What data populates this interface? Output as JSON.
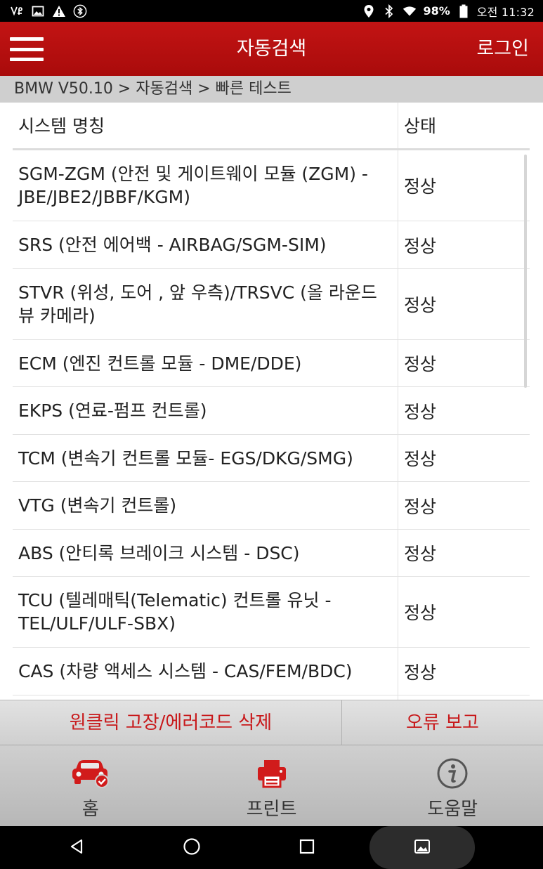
{
  "status_bar": {
    "battery": "98%",
    "time": "오전 11:32"
  },
  "app_bar": {
    "title": "자동검색",
    "login": "로그인"
  },
  "breadcrumb": "BMW V50.10 > 자동검색 > 빠른 테스트",
  "table": {
    "headers": [
      "시스템 명칭",
      "상태"
    ],
    "rows": [
      {
        "name": "SGM-ZGM (안전 및 게이트웨이 모듈 (ZGM) - JBE/JBE2/JBBF/KGM)",
        "status": "정상"
      },
      {
        "name": "SRS (안전 에어백 - AIRBAG/SGM-SIM)",
        "status": "정상"
      },
      {
        "name": "STVR (위성, 도어 , 앞 우측)/TRSVC (올 라운드 뷰 카메라)",
        "status": "정상"
      },
      {
        "name": "ECM (엔진 컨트롤 모듈 - DME/DDE)",
        "status": "정상"
      },
      {
        "name": "EKPS (연료-펌프 컨트롤)",
        "status": "정상"
      },
      {
        "name": "TCM (변속기 컨트롤 모듈- EGS/DKG/SMG)",
        "status": "정상"
      },
      {
        "name": "VTG (변속기 컨트롤)",
        "status": "정상"
      },
      {
        "name": "ABS (안티록 브레이크 시스템 - DSC)",
        "status": "정상"
      },
      {
        "name": "TCU (텔레매틱(Telematic) 컨트롤 유닛 - TEL/ULF/ULF-SBX)",
        "status": "정상"
      },
      {
        "name": "CAS (차량 액세스 시스템 - CAS/FEM/BDC)",
        "status": "정상"
      },
      {
        "name": "",
        "status": ""
      }
    ]
  },
  "actions": {
    "clear_codes": "원클릭 고장/에러코드 삭제",
    "report": "오류 보고"
  },
  "bottom_nav": [
    {
      "label": "홈",
      "icon": "car-check-icon"
    },
    {
      "label": "프린트",
      "icon": "printer-icon"
    },
    {
      "label": "도움말",
      "icon": "info-icon"
    }
  ],
  "colors": {
    "brand_red": "#b50f0f",
    "action_text": "#c8191b"
  }
}
